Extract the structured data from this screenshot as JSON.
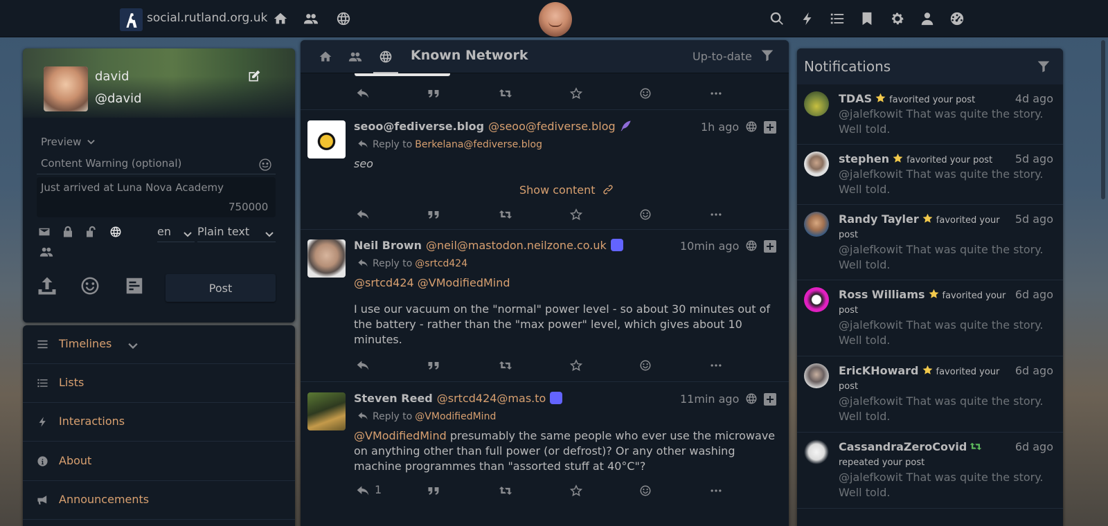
{
  "topbar": {
    "site_name": "social.rutland.org.uk",
    "icons": [
      "home-icon",
      "friends-icon",
      "globe-icon",
      "search-icon",
      "bolt-icon",
      "list-icon",
      "bookmark-icon",
      "gear-icon",
      "user-shield-icon",
      "dashboard-icon"
    ]
  },
  "user": {
    "name": "david",
    "handle": "@david"
  },
  "composer": {
    "preview_label": "Preview",
    "cw_placeholder": "Content Warning (optional)",
    "status_text": "Just arrived at Luna Nova Academy",
    "char_count": "750000",
    "language": "en",
    "format": "Plain text",
    "post_label": "Post"
  },
  "nav": {
    "items": [
      {
        "label": "Timelines",
        "icon": "bars-icon"
      },
      {
        "label": "Lists",
        "icon": "list-icon"
      },
      {
        "label": "Interactions",
        "icon": "bolt-icon"
      },
      {
        "label": "About",
        "icon": "info-icon"
      },
      {
        "label": "Announcements",
        "icon": "megaphone-icon"
      }
    ]
  },
  "timeline": {
    "title": "Known Network",
    "status": "Up-to-date",
    "posts": [
      {
        "name": "seoo@fediverse.blog",
        "acct": "@seoo@fediverse.blog",
        "time": "1h ago",
        "reply_label": "Reply to",
        "reply_to": "Berkelana@fediverse.blog",
        "body": "seo",
        "show_content": "Show content"
      },
      {
        "name": "Neil Brown",
        "acct": "@neil@mastodon.neilzone.co.uk",
        "time": "10min ago",
        "reply_label": "Reply to",
        "reply_to": "@srtcd424",
        "mention1": "@srtcd424",
        "mention2": "@VModifiedMind",
        "body": "I use our vacuum on the \"normal\" power level - so about 30 minutes out of the battery - rather than the \"max power\" level, which gives about 10 minutes."
      },
      {
        "name": "Steven Reed",
        "acct": "@srtcd424@mas.to",
        "time": "11min ago",
        "reply_label": "Reply to",
        "reply_to": "@VModifiedMind",
        "mention": "@VModifiedMind",
        "body": " presumably the same people who ever use the microwave on anything other than full power (or defrost)? Or any other washing machine programmes than \"assorted stuff at 40°C\"?",
        "reply_count": "1"
      }
    ]
  },
  "notifications": {
    "title": "Notifications",
    "items": [
      {
        "name": "TDAS",
        "action": "favorited your post",
        "action_line2": "",
        "time": "4d ago",
        "excerpt": "@jalefkowit That was quite the story. Well told.",
        "avatar_color": "#6b7d3a"
      },
      {
        "name": "stephen",
        "action": "favorited your post",
        "action_line2": "",
        "time": "5d ago",
        "excerpt": "@jalefkowit That was quite the story. Well told.",
        "avatar_color": "#d9d9d9"
      },
      {
        "name": "Randy Tayler",
        "action": "favorited your",
        "action_line2": "post",
        "time": "5d ago",
        "excerpt": "@jalefkowit That was quite the story. Well told.",
        "avatar_color": "#8a6a4a"
      },
      {
        "name": "Ross Williams",
        "action": "favorited your",
        "action_line2": "post",
        "time": "6d ago",
        "excerpt": "@jalefkowit That was quite the story. Well told.",
        "avatar_color": "#e020c0"
      },
      {
        "name": "EricKHoward",
        "action": "favorited your",
        "action_line2": "post",
        "time": "6d ago",
        "excerpt": "@jalefkowit That was quite the story. Well told.",
        "avatar_color": "#b0b0b0"
      },
      {
        "name": "CassandraZeroCovid",
        "action": "",
        "action_line2": "repeated your post",
        "time": "6d ago",
        "excerpt": "@jalefkowit That was quite the story. Well told.",
        "avatar_color": "#e8e8e8"
      }
    ]
  },
  "colors": {
    "bg": "#121a24",
    "link": "#d8a070",
    "text": "#b9b9ba",
    "muted": "#8a8c90",
    "star": "#f2c94c",
    "repeat": "#5cb85c",
    "mastodon": "#6364ff"
  }
}
